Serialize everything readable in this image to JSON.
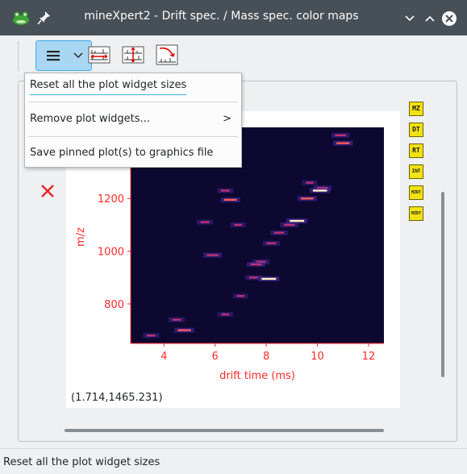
{
  "window": {
    "title": "mineXpert2 - Drift spec. / Mass spec. color maps",
    "icons": [
      "app-frog-icon",
      "pin-icon",
      "minimize-icon",
      "maximize-icon",
      "close-icon"
    ]
  },
  "toolbar": {
    "menu_button_icon": "hamburger-menu-icon",
    "icons": [
      "horizontal-sync-icon",
      "vertical-sync-icon",
      "rewind-icon"
    ]
  },
  "context_menu": {
    "items": [
      {
        "label": "Reset all the plot widget sizes",
        "has_submenu": false
      },
      {
        "label": "Remove plot widgets...",
        "has_submenu": true,
        "chevron": ">"
      },
      {
        "label": "Save pinned plot(s) to graphics file",
        "has_submenu": false
      }
    ]
  },
  "plot": {
    "coords_readout": "(1.714,1465.231)",
    "close_icon": "red-x-icon",
    "side_buttons": [
      {
        "label": "MZ",
        "icon": "mz-arrow-icon"
      },
      {
        "label": "DT",
        "icon": "dt-arrow-icon"
      },
      {
        "label": "RT",
        "icon": "rt-arrow-icon"
      },
      {
        "label": "INT",
        "icon": "int-arrow-icon"
      },
      {
        "label": "MZRT",
        "icon": "mz-rt-colormap-icon"
      },
      {
        "label": "MZDT",
        "icon": "mz-dt-colormap-icon"
      }
    ]
  },
  "chart_data": {
    "type": "heatmap",
    "title": "",
    "xlabel": "drift time (ms)",
    "ylabel": "m/z",
    "xlim": [
      2.7,
      12.6
    ],
    "ylim": [
      650,
      1470
    ],
    "x_ticks": [
      "4",
      "6",
      "8",
      "10",
      "12"
    ],
    "y_ticks": [
      "800",
      "1000",
      "1200"
    ],
    "colors": {
      "background": "#0d0830",
      "axis": "#ff2a2a"
    },
    "points": [
      {
        "x": 10.9,
        "y": 1440,
        "i": 0.6
      },
      {
        "x": 11.0,
        "y": 1410,
        "i": 0.85
      },
      {
        "x": 10.2,
        "y": 1240,
        "i": 0.6
      },
      {
        "x": 10.1,
        "y": 1230,
        "i": 0.95
      },
      {
        "x": 9.6,
        "y": 1200,
        "i": 0.8
      },
      {
        "x": 6.6,
        "y": 1195,
        "i": 0.8
      },
      {
        "x": 6.4,
        "y": 1230,
        "i": 0.4
      },
      {
        "x": 9.2,
        "y": 1115,
        "i": 1.0
      },
      {
        "x": 8.9,
        "y": 1100,
        "i": 0.6
      },
      {
        "x": 8.5,
        "y": 1070,
        "i": 0.5
      },
      {
        "x": 8.2,
        "y": 1030,
        "i": 0.5
      },
      {
        "x": 5.9,
        "y": 985,
        "i": 0.7
      },
      {
        "x": 7.8,
        "y": 960,
        "i": 0.5
      },
      {
        "x": 7.6,
        "y": 950,
        "i": 0.7
      },
      {
        "x": 8.1,
        "y": 895,
        "i": 1.0
      },
      {
        "x": 7.5,
        "y": 900,
        "i": 0.4
      },
      {
        "x": 4.8,
        "y": 700,
        "i": 0.85
      },
      {
        "x": 4.5,
        "y": 740,
        "i": 0.4
      },
      {
        "x": 6.4,
        "y": 760,
        "i": 0.3
      },
      {
        "x": 7.0,
        "y": 830,
        "i": 0.3
      },
      {
        "x": 6.9,
        "y": 1100,
        "i": 0.3
      },
      {
        "x": 5.6,
        "y": 1110,
        "i": 0.4
      },
      {
        "x": 3.5,
        "y": 680,
        "i": 0.4
      },
      {
        "x": 9.7,
        "y": 1260,
        "i": 0.3
      }
    ]
  }
}
